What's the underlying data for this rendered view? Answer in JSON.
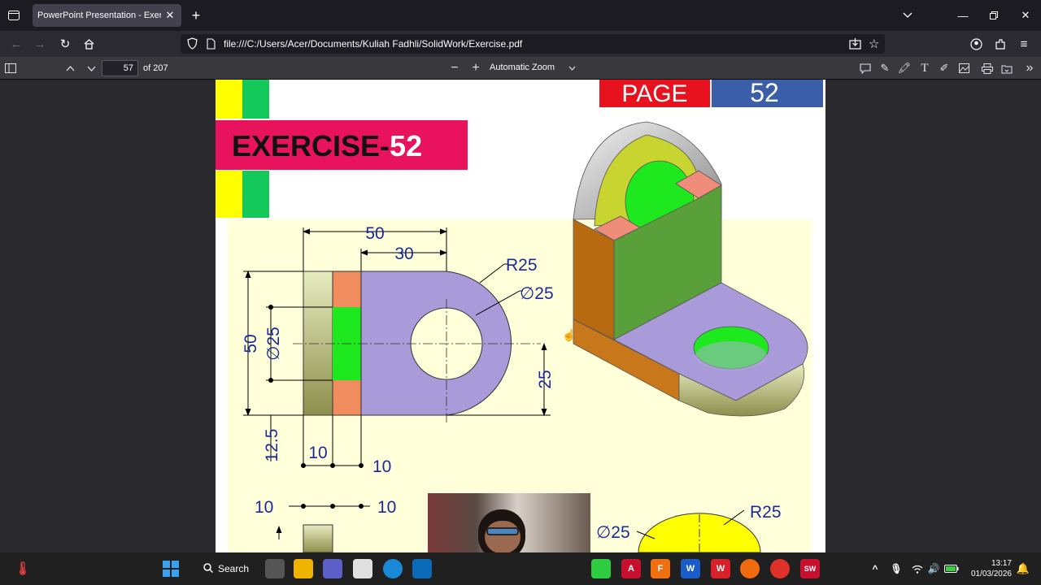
{
  "browser": {
    "tab_title": "PowerPoint Presentation - Exercise.pdf",
    "url": "file:///C:/Users/Acer/Documents/Kuliah Fadhli/SolidWork/Exercise.pdf"
  },
  "pdf_toolbar": {
    "page_number": "57",
    "page_count": "of 207",
    "zoom": "Automatic Zoom"
  },
  "document": {
    "page_label": "PAGE",
    "page_value": "52",
    "exercise_prefix": "EXERCISE-",
    "exercise_number": "52",
    "dims": {
      "d50_top": "50",
      "d30": "30",
      "r25_top": "R25",
      "phi25_right": "∅25",
      "d50_left": "50",
      "phi25_left": "∅25",
      "d25": "25",
      "d12_5": "12.5",
      "d10_a": "10",
      "d10_b": "10",
      "d10_c": "10",
      "d10_d": "10",
      "phi25_lower": "∅25",
      "r25_lower": "R25"
    }
  },
  "taskbar": {
    "search_label": "Search",
    "time": "13:17",
    "date": "01/03/2026"
  },
  "colors": {
    "magenta": "#e8125d",
    "red": "#e8121e",
    "blue": "#3a5ea8",
    "lavender": "#a99ad9",
    "green": "#1ee81e",
    "orange": "#f08060",
    "yellow": "#ffff00",
    "dim_blue": "#1a2a9a"
  }
}
